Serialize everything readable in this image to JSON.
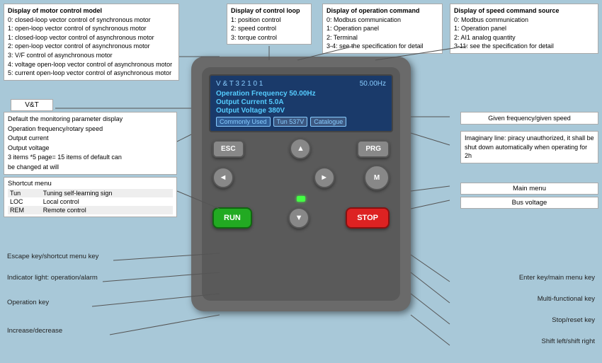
{
  "topAnnotations": {
    "box1": {
      "title": "Display of motor control model",
      "lines": [
        "0: closed-loop vector control of synchronous motor",
        "1: open-loop vector control of synchronous motor",
        "1: closed-loop vector control of asynchronous motor",
        "2: open-loop vector control of asynchronous motor",
        "3: V/F control of asynchronous motor",
        "4: voltage open-loop vector control of asynchronous motor",
        "5: current open-loop vector control of asynchronous motor"
      ]
    },
    "box2": {
      "title": "Display of control loop",
      "lines": [
        "1: position control",
        "2: speed control",
        "3: torque control"
      ]
    },
    "box3": {
      "title": "Display of operation command",
      "lines": [
        "0: Modbus communication",
        "1: Operation panel",
        "2: Terminal",
        "3-4: see the specification for detail"
      ]
    },
    "box4": {
      "title": "Display of speed command source",
      "lines": [
        "0: Modbus communication",
        "1: Operation panel",
        "2: AI1 analog quantity",
        "3-11: see the specification for detail"
      ]
    }
  },
  "vtLabel": "V&T",
  "monitorBox": {
    "lines": [
      "Default the monitoring parameter display",
      "Operation frequency/rotary speed",
      "Output current",
      "Output voltage",
      "3 items *5 page= 15 items of default can",
      "be changed at will"
    ]
  },
  "shortcutMenu": {
    "title": "Shortcut menu",
    "rows": [
      {
        "col1": "Tun",
        "col2": "Tuning self-learning sign"
      },
      {
        "col1": "LOC",
        "col2": "Local control"
      },
      {
        "col1": "REM",
        "col2": "Remote control"
      }
    ]
  },
  "lcd": {
    "topLeft": "V & T 3 2 1 0 1",
    "topRight": "50.00Hz",
    "line1": "Operation Frequency  50.00Hz",
    "line2": "Output Current         5.0A",
    "line3": "Output Voltage         380V",
    "tab1": "Commonly Used",
    "tab2": "Tun  537V",
    "tab3": "Catalogue"
  },
  "buttons": {
    "esc": "ESC",
    "prg": "PRG",
    "run": "RUN",
    "stop": "STOP",
    "m": "M",
    "up": "▲",
    "down": "▼",
    "left": "◄",
    "right": "►"
  },
  "rightAnnotations": {
    "givenFreq": "Given frequency/given speed",
    "imaginary": "Imaginary line: piracy unauthorized, it shall be shut down automatically when operating for 2h",
    "mainMenu": "Main menu",
    "busVoltage": "Bus voltage",
    "enterKey": "Enter key/main menu key",
    "multiFunctional": "Multi-functional key",
    "stopReset": "Stop/reset key",
    "shiftRight": "Shift left/shift right"
  },
  "leftLabels": {
    "escapeKey": "Escape key/shortcut menu key",
    "indicatorLight": "Indicator light: operation/alarm",
    "operationKey": "Operation key",
    "increaseDecrease": "Increase/decrease"
  }
}
